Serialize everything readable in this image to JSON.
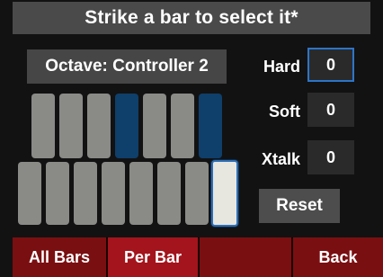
{
  "title": "Strike a bar to select it*",
  "octave_label": "Octave: Controller 2",
  "bars": {
    "upper": [
      "normal",
      "normal",
      "normal",
      "blue",
      "normal",
      "normal",
      "blue"
    ],
    "lower": [
      "normal",
      "normal",
      "normal",
      "normal",
      "normal",
      "normal",
      "normal",
      "selected"
    ]
  },
  "params": {
    "hard": {
      "label": "Hard",
      "value": "0"
    },
    "soft": {
      "label": "Soft",
      "value": "0"
    },
    "xtalk": {
      "label": "Xtalk",
      "value": "0"
    }
  },
  "reset_label": "Reset",
  "tabs": {
    "all_bars": "All Bars",
    "per_bar": "Per Bar",
    "blank": "",
    "back": "Back"
  },
  "colors": {
    "accent_blue": "#2d75c8",
    "bar_gray": "#8a8a87",
    "bar_blue": "#0f3f6b",
    "selected_bar": "#e7e6df",
    "bottom_red": "#7a0f12",
    "active_tab_red": "#a3141c"
  }
}
